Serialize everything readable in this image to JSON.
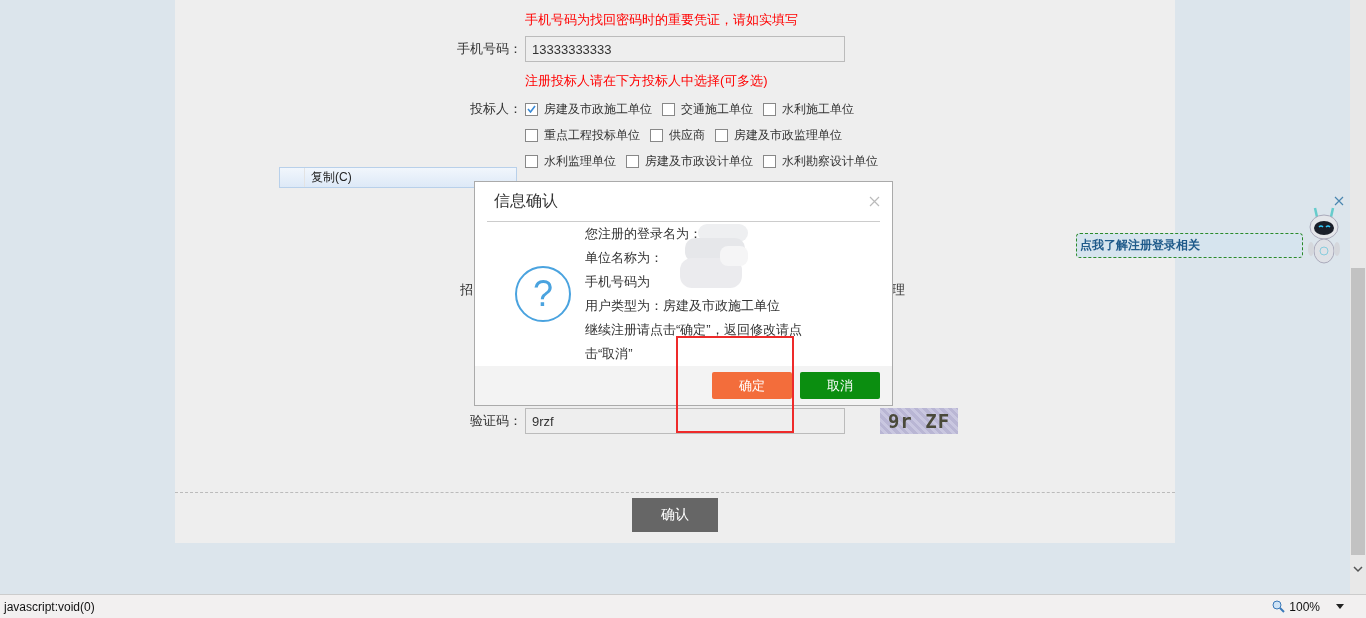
{
  "form": {
    "phone_hint": "手机号码为找回密码时的重要凭证，请如实填写",
    "phone": {
      "label": "手机号码：",
      "value": "13333333333"
    },
    "bidder_hint": "注册投标人请在下方投标人中选择(可多选)",
    "bidder": {
      "label": "投标人：",
      "rows": [
        [
          {
            "label": "房建及市政施工单位",
            "checked": true
          },
          {
            "label": "交通施工单位",
            "checked": false
          },
          {
            "label": "水利施工单位",
            "checked": false
          }
        ],
        [
          {
            "label": "重点工程投标单位",
            "checked": false
          },
          {
            "label": "供应商",
            "checked": false
          },
          {
            "label": "房建及市政监理单位",
            "checked": false
          }
        ],
        [
          {
            "label": "水利监理单位",
            "checked": false
          },
          {
            "label": "房建及市政设计单位",
            "checked": false
          },
          {
            "label": "水利勘察设计单位",
            "checked": false
          }
        ]
      ]
    },
    "covered_row": {
      "label": "招",
      "trailing": "理"
    },
    "captcha": {
      "label": "验证码：",
      "value": "9rzf",
      "image_text": "9r ZF"
    }
  },
  "submit_button": "确认",
  "context_menu": {
    "items": [
      "复制(C)"
    ]
  },
  "dialog": {
    "title": "信息确认",
    "icon": "?",
    "lines": [
      "您注册的登录名为：",
      "单位名称为：",
      "手机号码为",
      "用户类型为：房建及市政施工单位",
      "继续注册请点击“确定”，返回修改请点击“取消”"
    ],
    "buttons": [
      {
        "label": "确定",
        "kind": "confirm"
      },
      {
        "label": "取消",
        "kind": "cancel"
      }
    ]
  },
  "helper": {
    "bubble": "点我了解注册登录相关"
  },
  "status_bar": {
    "url": "javascript:void(0)",
    "zoom": "100%"
  }
}
